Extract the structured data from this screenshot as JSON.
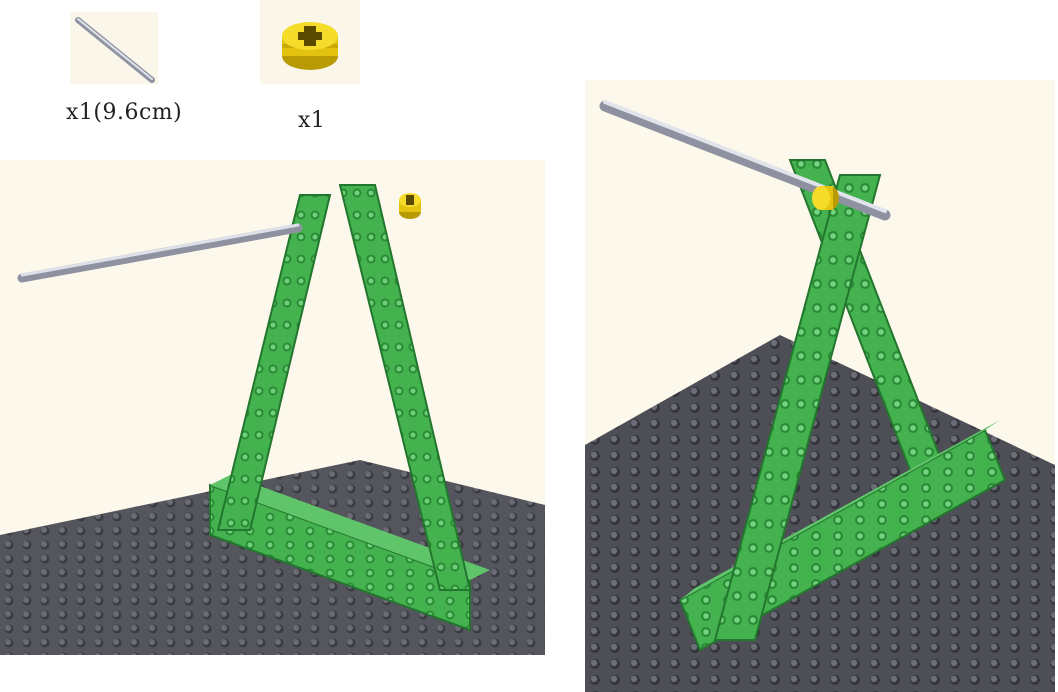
{
  "parts": [
    {
      "name": "axle",
      "icon": "axle-9-6cm-icon",
      "label": "x1(9.6cm)"
    },
    {
      "name": "bush",
      "icon": "yellow-bush-icon",
      "label": "x1"
    }
  ],
  "colors": {
    "beam_green": "#3fae4a",
    "beam_green_dark": "#23762d",
    "baseplate": "#4a4a52",
    "axle_silver": "#b9bcc6",
    "bush_yellow": "#f2d21a",
    "background": "#fdf8ec"
  }
}
